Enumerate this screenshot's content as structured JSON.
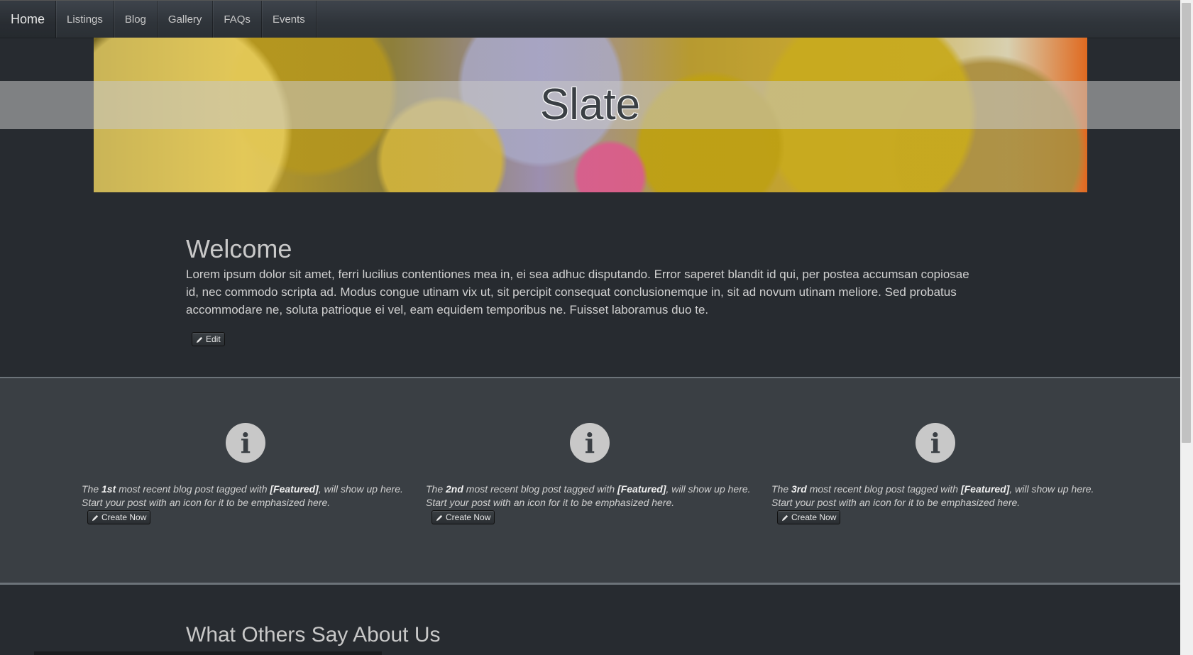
{
  "nav": {
    "items": [
      {
        "label": "Home"
      },
      {
        "label": "Listings"
      },
      {
        "label": "Blog"
      },
      {
        "label": "Gallery"
      },
      {
        "label": "FAQs"
      },
      {
        "label": "Events"
      }
    ]
  },
  "hero": {
    "title": "Slate"
  },
  "welcome": {
    "heading": "Welcome",
    "body": "Lorem ipsum dolor sit amet, ferri lucilius contentiones mea in, ei sea adhuc disputando. Error saperet blandit id qui, per postea accumsan copiosae id, nec commodo scripta ad. Modus congue utinam vix ut, sit percipit consequat conclusionemque in, sit ad novum utinam meliore. Sed probatus accommodare ne, soluta patrioque ei vel, eam equidem temporibus ne. Fuisset laboramus duo te.",
    "edit_label": "Edit"
  },
  "features": [
    {
      "prefix": "The ",
      "ordinal": "1st",
      "middle": " most recent blog post tagged with ",
      "tag": "[Featured]",
      "suffix": ", will show up here.",
      "line2": "Start your post with an icon for it to be emphasized here.",
      "button": "Create Now",
      "icon": "info-icon"
    },
    {
      "prefix": "The ",
      "ordinal": "2nd",
      "middle": " most recent blog post tagged with ",
      "tag": "[Featured]",
      "suffix": ", will show up here.",
      "line2": "Start your post with an icon for it to be emphasized here.",
      "button": "Create Now",
      "icon": "info-icon"
    },
    {
      "prefix": "The ",
      "ordinal": "3rd",
      "middle": " most recent blog post tagged with ",
      "tag": "[Featured]",
      "suffix": ", will show up here.",
      "line2": "Start your post with an icon for it to be emphasized here.",
      "button": "Create Now",
      "icon": "info-icon"
    }
  ],
  "testimonials": {
    "heading": "What Others Say About Us"
  },
  "colors": {
    "background": "#272b30",
    "features_bg": "#3a3f44",
    "text": "#c8c8c8"
  }
}
